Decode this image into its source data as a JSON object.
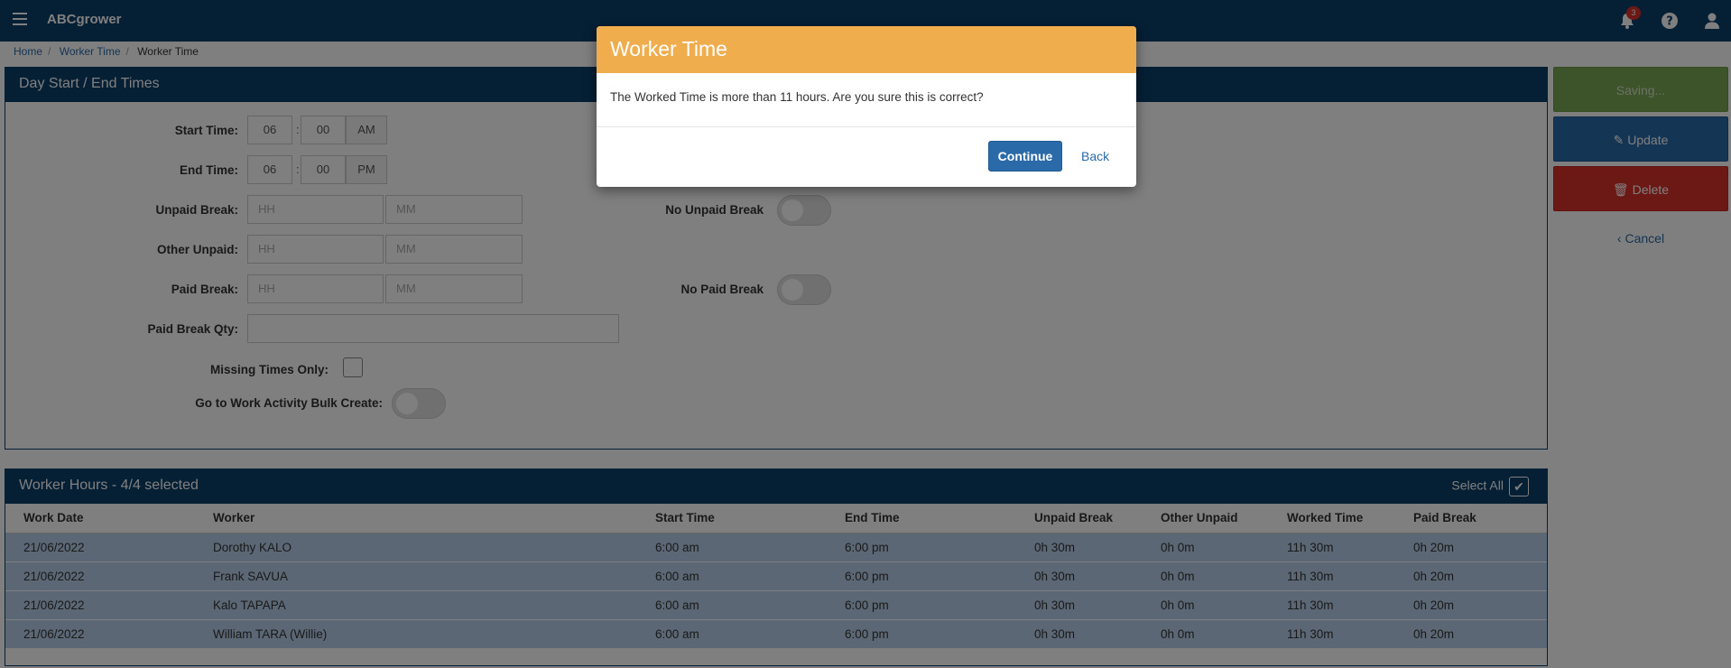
{
  "app": {
    "name": "ABCgrower",
    "notification_count": "3"
  },
  "breadcrumb": [
    "Home",
    "Worker Time",
    "Worker Time"
  ],
  "day_panel": {
    "title": "Day Start / End Times",
    "start_time": {
      "label": "Start Time:",
      "hh": "06",
      "mm": "00",
      "ampm": "AM"
    },
    "end_time": {
      "label": "End Time:",
      "hh": "06",
      "mm": "00",
      "ampm": "PM"
    },
    "unpaid_break": {
      "label": "Unpaid Break:",
      "hh_placeholder": "HH",
      "mm_placeholder": "MM"
    },
    "other_unpaid": {
      "label": "Other Unpaid:",
      "hh_placeholder": "HH",
      "mm_placeholder": "MM"
    },
    "paid_break": {
      "label": "Paid Break:",
      "hh_placeholder": "HH",
      "mm_placeholder": "MM"
    },
    "paid_break_qty": {
      "label": "Paid Break Qty:"
    },
    "no_unpaid_break": "No Unpaid Break",
    "no_paid_break": "No Paid Break",
    "missing_times_only": "Missing Times Only:",
    "bulk_create": "Go to Work Activity Bulk Create:"
  },
  "hours_panel": {
    "title": "Worker Hours - 4/4 selected",
    "select_all": "Select All",
    "columns": [
      "Work Date",
      "Worker",
      "Start Time",
      "End Time",
      "Unpaid Break",
      "Other Unpaid",
      "Worked Time",
      "Paid Break"
    ],
    "rows": [
      [
        "21/06/2022",
        "Dorothy KALO",
        "6:00 am",
        "6:00 pm",
        "0h 30m",
        "0h 0m",
        "11h 30m",
        "0h 20m"
      ],
      [
        "21/06/2022",
        "Frank SAVUA",
        "6:00 am",
        "6:00 pm",
        "0h 30m",
        "0h 0m",
        "11h 30m",
        "0h 20m"
      ],
      [
        "21/06/2022",
        "Kalo TAPAPA",
        "6:00 am",
        "6:00 pm",
        "0h 30m",
        "0h 0m",
        "11h 30m",
        "0h 20m"
      ],
      [
        "21/06/2022",
        "William TARA (Willie)",
        "6:00 am",
        "6:00 pm",
        "0h 30m",
        "0h 0m",
        "11h 30m",
        "0h 20m"
      ]
    ]
  },
  "actions": {
    "saving": "Saving...",
    "update": "Update",
    "delete": "Delete",
    "cancel": "Cancel"
  },
  "modal": {
    "title": "Worker Time",
    "message": "The Worked Time is more than 11 hours. Are you sure this is correct?",
    "continue": "Continue",
    "back": "Back"
  },
  "colors": {
    "header": "#0b3e6b",
    "modal_header": "#f0ad4e",
    "primary": "#2a6aa8",
    "danger": "#d9312b",
    "success": "#7aa654"
  }
}
